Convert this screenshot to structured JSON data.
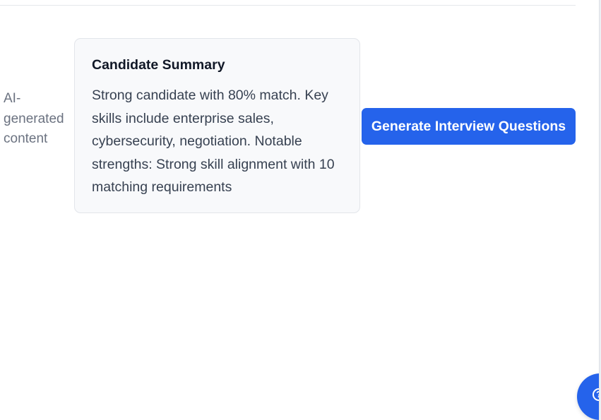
{
  "ai_note": {
    "text": "AI-generated content"
  },
  "summary_card": {
    "title": "Candidate Summary",
    "body": "Strong candidate with 80% match. Key skills include enterprise sales, cybersecurity, negotiation. Notable strengths: Strong skill alignment with 10 matching requirements"
  },
  "actions": {
    "generate_label": "Generate Interview Questions"
  },
  "help_button": {
    "icon": "help-icon",
    "glyph": "?"
  },
  "colors": {
    "primary": "#2563eb",
    "muted_text": "#6b7280",
    "card_bg": "#f8f9fb",
    "card_border": "#e2e5ea"
  }
}
